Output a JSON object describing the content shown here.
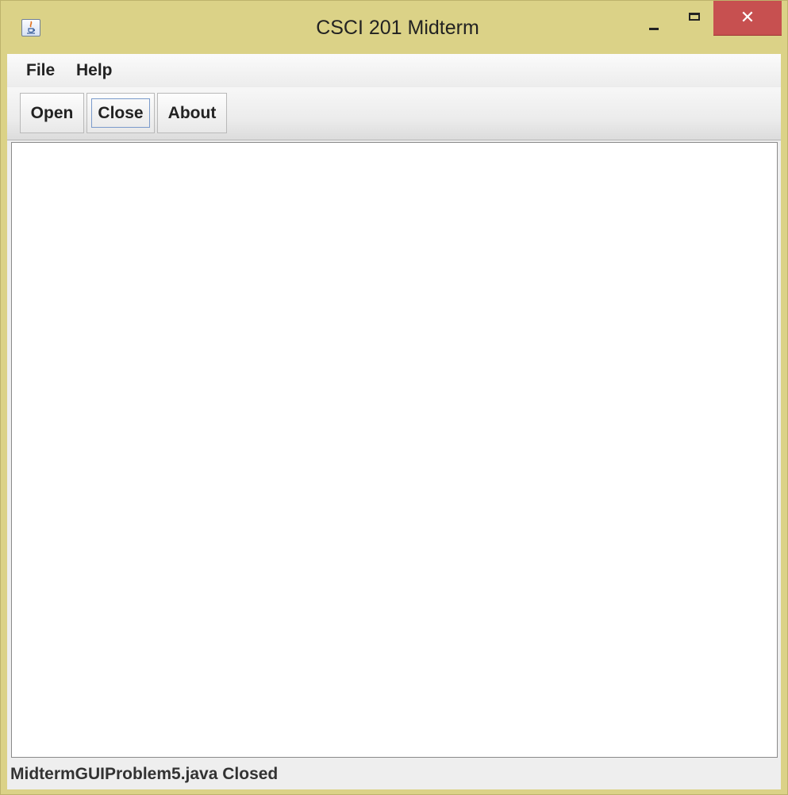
{
  "window": {
    "title": "CSCI 201 Midterm",
    "icon": "java-app-icon",
    "controls": {
      "minimize_icon": "minimize-icon",
      "maximize_icon": "maximize-icon",
      "close_glyph": "✕"
    }
  },
  "menubar": {
    "items": [
      {
        "label": "File"
      },
      {
        "label": "Help"
      }
    ]
  },
  "toolbar": {
    "open_label": "Open",
    "close_label": "Close",
    "about_label": "About"
  },
  "status": {
    "text": "MidtermGUIProblem5.java Closed"
  },
  "colors": {
    "window_frame": "#dbd287",
    "close_button": "#c75050",
    "client_background": "#eeeeee",
    "content_background": "#ffffff"
  }
}
